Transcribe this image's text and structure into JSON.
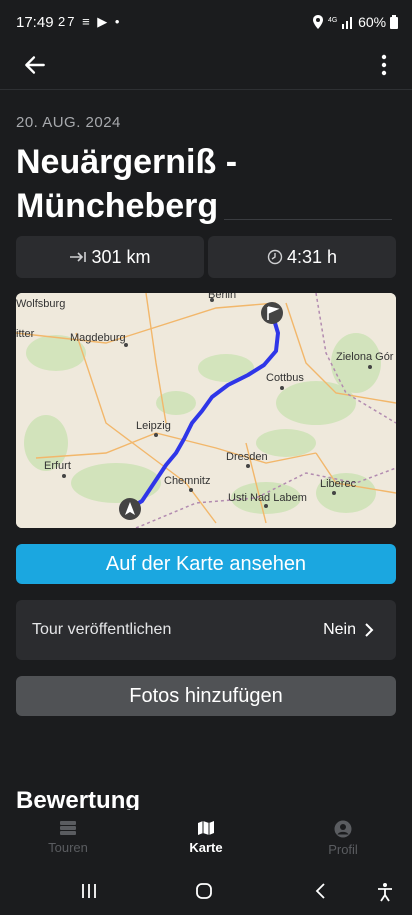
{
  "status_bar": {
    "time": "17:49",
    "notifications": "27 ≡ ▶ •",
    "battery": "60%"
  },
  "header": {
    "date": "20. AUG. 2024",
    "title": "Neuärgerniß - Müncheberg"
  },
  "stats": {
    "distance": "301 km",
    "duration": "4:31 h"
  },
  "map": {
    "labels": [
      "Berlin",
      "Wolfsburg",
      "itter",
      "Magdeburg",
      "Zielona Gór",
      "Cottbus",
      "Leipzig",
      "Dresden",
      "Erfurt",
      "Chemnitz",
      "Usti Nad Labem",
      "Liberec"
    ],
    "route_color": "#2f36e8"
  },
  "actions": {
    "view_on_map": "Auf der Karte ansehen",
    "add_photos": "Fotos hinzufügen"
  },
  "publish": {
    "label": "Tour veröffentlichen",
    "value": "Nein"
  },
  "section": {
    "rating_title": "Bewertung"
  },
  "nav": {
    "tours": "Touren",
    "map": "Karte",
    "profile": "Profil",
    "active": "Karte"
  }
}
